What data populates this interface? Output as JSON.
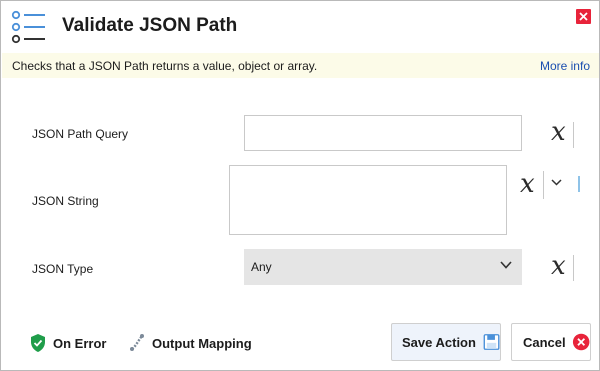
{
  "header": {
    "title": "Validate JSON Path",
    "icon": "list-icon",
    "close_icon": "close-icon",
    "close_color": "#e8233a"
  },
  "infobar": {
    "description": "Checks that a JSON Path returns a value, object or array.",
    "more_info_label": "More info",
    "background": "#fcfbe8",
    "link_color": "#1b4fb0"
  },
  "form": {
    "json_path_query": {
      "label": "JSON Path Query",
      "value": ""
    },
    "json_string": {
      "label": "JSON String",
      "value": ""
    },
    "json_type": {
      "label": "JSON Type",
      "selected": "Any"
    },
    "variable_symbol": "x"
  },
  "footer": {
    "on_error_label": "On Error",
    "output_mapping_label": "Output Mapping",
    "save_label": "Save Action",
    "cancel_label": "Cancel"
  }
}
